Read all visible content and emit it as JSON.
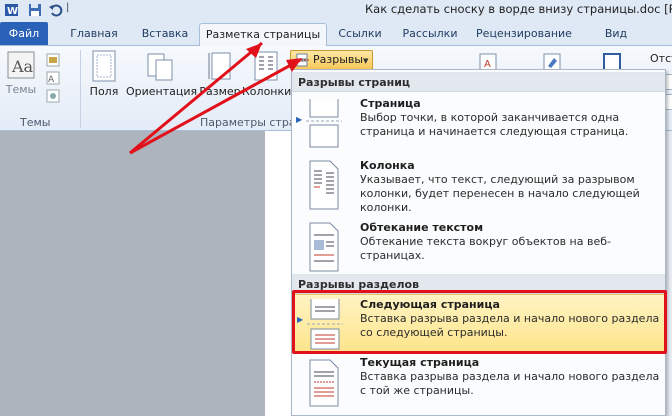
{
  "window": {
    "title": "Как сделать сноску в ворде внизу страницы.doc [Реж"
  },
  "tabs": [
    {
      "label": "Файл"
    },
    {
      "label": "Главная"
    },
    {
      "label": "Вставка"
    },
    {
      "label": "Разметка страницы"
    },
    {
      "label": "Ссылки"
    },
    {
      "label": "Рассылки"
    },
    {
      "label": "Рецензирование"
    },
    {
      "label": "Вид"
    }
  ],
  "ribbon": {
    "themes_label": "Темы",
    "themes_group": "Темы",
    "fields_label": "Поля",
    "orientation_label": "Ориентация",
    "size_label": "Размер",
    "columns_label": "Колонки",
    "page_setup_group": "Параметры стран",
    "breaks_label": "Разрывы",
    "indent_label": "Отст"
  },
  "dropdown": {
    "page_breaks_header": "Разрывы страниц",
    "section_breaks_header": "Разрывы разделов",
    "items": [
      {
        "title": "Страница",
        "desc": "Выбор точки, в которой заканчивается одна страница и начинается следующая страница."
      },
      {
        "title": "Колонка",
        "desc": "Указывает, что текст, следующий за разрывом колонки, будет перенесен в начало следующей колонки."
      },
      {
        "title": "Обтекание текстом",
        "desc": "Обтекание текста вокруг объектов на веб-страницах."
      },
      {
        "title": "Следующая страница",
        "desc": "Вставка разрыва раздела и начало нового раздела со следующей страницы."
      },
      {
        "title": "Текущая страница",
        "desc": "Вставка разрыва раздела и начало нового раздела с той же страницы."
      }
    ]
  },
  "colors": {
    "file_tab": "#2a62b8",
    "highlight": "#fde58c",
    "annotation_red": "#e0111b"
  }
}
